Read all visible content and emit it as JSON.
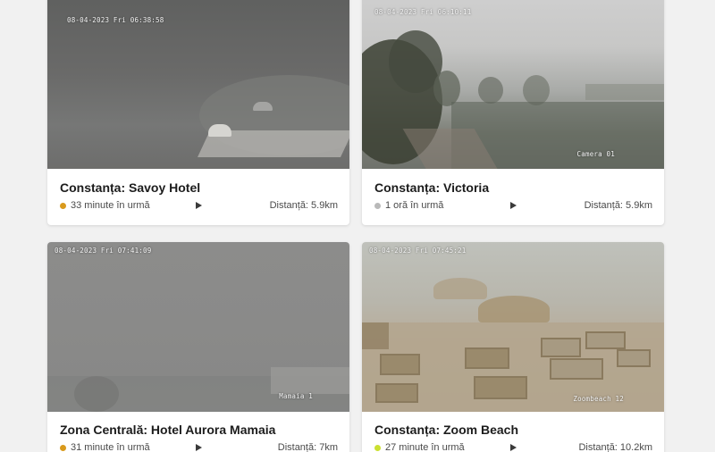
{
  "cards": [
    {
      "title": "Constanța: Savoy Hotel",
      "timestamp": "08-04-2023 Fri 06:38:58",
      "camera_label": "",
      "ago": "33 minute în urmă",
      "distance": "Distanță: 5.9km",
      "status_color": "#d99a1c",
      "play_icon": "play-icon"
    },
    {
      "title": "Constanța: Victoria",
      "timestamp": "08-04-2023 Fri 06:10:11",
      "camera_label": "Camera 01",
      "ago": "1 oră în urmă",
      "distance": "Distanță: 5.9km",
      "status_color": "#b9b9b9",
      "play_icon": "play-icon"
    },
    {
      "title": "Zona Centrală: Hotel Aurora Mamaia",
      "timestamp": "08-04-2023 Fri 07:41:09",
      "camera_label": "Mamaia 1",
      "ago": "31 minute în urmă",
      "distance": "Distanță: 7km",
      "status_color": "#d99a1c",
      "play_icon": "play-icon"
    },
    {
      "title": "Constanța: Zoom Beach",
      "timestamp": "08-04-2023 Fri 07:45:21",
      "camera_label": "Zoombeach 12",
      "ago": "27 minute în urmă",
      "distance": "Distanță: 10.2km",
      "status_color": "#cbe031",
      "play_icon": "play-icon"
    }
  ]
}
